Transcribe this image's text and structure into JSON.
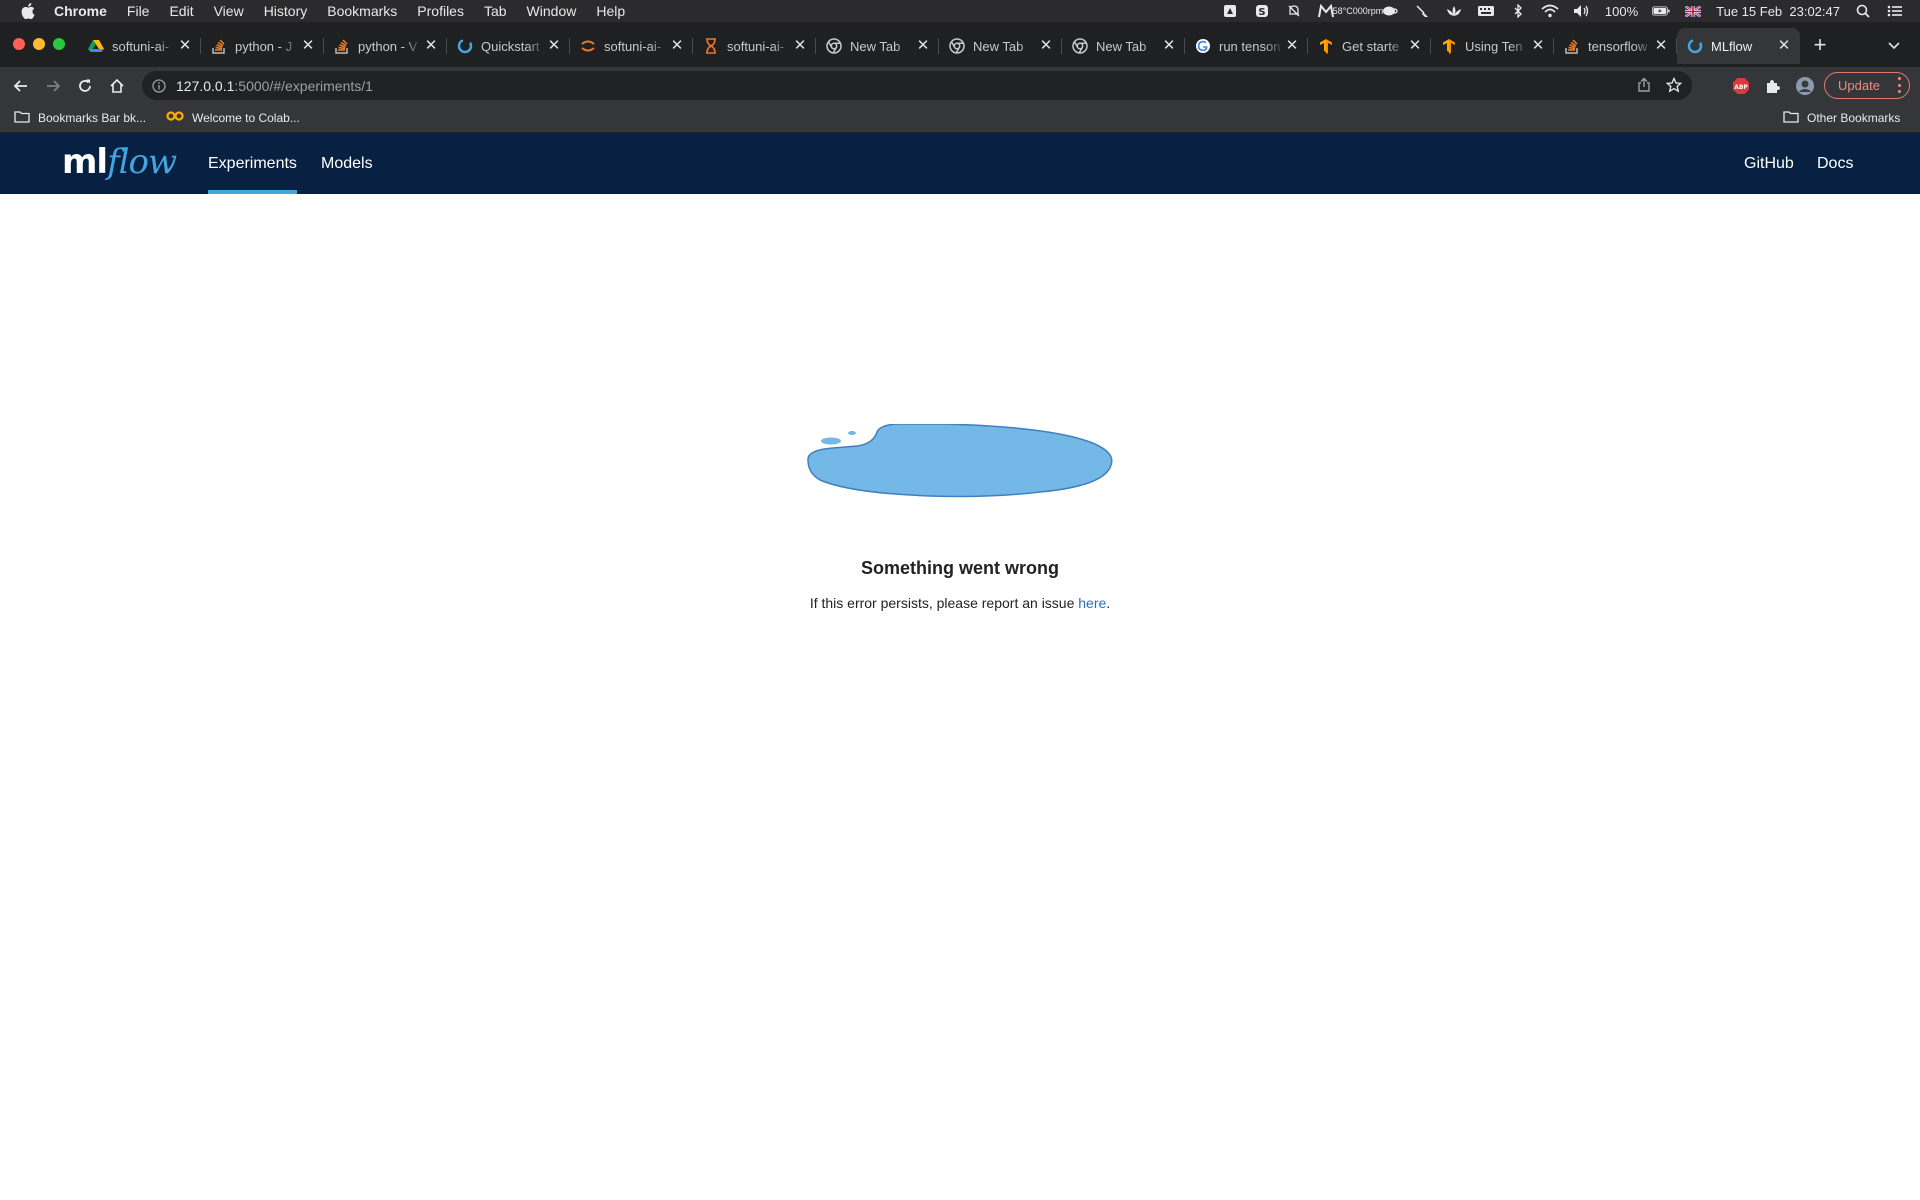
{
  "menubar": {
    "app": "Chrome",
    "items": [
      "File",
      "Edit",
      "View",
      "History",
      "Bookmarks",
      "Profiles",
      "Tab",
      "Window",
      "Help"
    ],
    "temp": "58°C",
    "fan": "000rpm",
    "battery": "100%",
    "datetime": "Tue 15 Feb  23:02:47"
  },
  "tabs": [
    {
      "title": "softuni-ai-",
      "icon": "google-drive-icon"
    },
    {
      "title": "python - J",
      "icon": "stackoverflow-icon"
    },
    {
      "title": "python - V",
      "icon": "stackoverflow-icon"
    },
    {
      "title": "Quickstart",
      "icon": "mlflow-icon"
    },
    {
      "title": "softuni-ai-",
      "icon": "jupyter-icon"
    },
    {
      "title": "softuni-ai-",
      "icon": "hourglass-icon"
    },
    {
      "title": "New Tab",
      "icon": "chrome-icon"
    },
    {
      "title": "New Tab",
      "icon": "chrome-icon"
    },
    {
      "title": "New Tab",
      "icon": "chrome-icon"
    },
    {
      "title": "run tenson",
      "icon": "google-icon"
    },
    {
      "title": "Get starte",
      "icon": "tensorflow-icon"
    },
    {
      "title": "Using Ten",
      "icon": "tensorflow-icon"
    },
    {
      "title": "tensorflow",
      "icon": "stackoverflow-icon"
    },
    {
      "title": "MLflow",
      "icon": "mlflow-icon",
      "active": true
    }
  ],
  "toolbar": {
    "url_host": "127.0.0.1",
    "url_path": ":5000/#/experiments/1",
    "update_label": "Update"
  },
  "bookmarks": {
    "folder": "Bookmarks Bar bk...",
    "colab": "Welcome to Colab...",
    "other": "Other Bookmarks"
  },
  "mlflow": {
    "logo_ml": "ml",
    "logo_flow": "flow",
    "nav_experiments": "Experiments",
    "nav_models": "Models",
    "nav_github": "GitHub",
    "nav_docs": "Docs"
  },
  "error": {
    "title": "Something went wrong",
    "message_prefix": "If this error persists, please report an issue ",
    "link_text": "here",
    "message_suffix": "."
  },
  "colors": {
    "header_bg": "#082142",
    "accent": "#43a6e0",
    "puddle": "#73b8e6",
    "link": "#2e6dbf"
  }
}
